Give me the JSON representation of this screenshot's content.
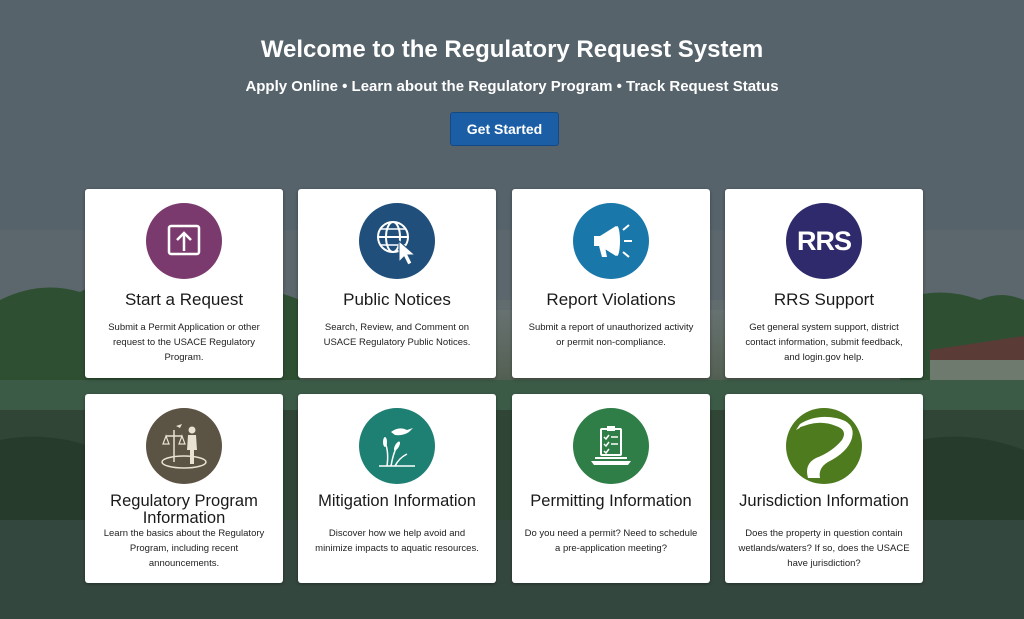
{
  "hero": {
    "title": "Welcome to the Regulatory Request System",
    "subtitle": "Apply Online • Learn about the Regulatory Program • Track Request Status",
    "cta_label": "Get Started"
  },
  "cards": [
    {
      "title": "Start a Request",
      "description": "Submit a Permit Application or other request to the USACE Regulatory Program.",
      "icon": "upload-icon",
      "color": "#7b3a6e"
    },
    {
      "title": "Public Notices",
      "description": "Search, Review, and Comment on USACE Regulatory Public Notices.",
      "icon": "globe-cursor-icon",
      "color": "#1f4f7a"
    },
    {
      "title": "Report Violations",
      "description": "Submit a report of unauthorized activity or permit non-compliance.",
      "icon": "megaphone-icon",
      "color": "#1a77a9"
    },
    {
      "title": "RRS Support",
      "description": "Get general system support, district contact information, submit feedback, and login.gov help.",
      "icon": "rrs-logo",
      "icon_text": "RRS",
      "color": "#2e2a6b"
    },
    {
      "title": "Regulatory Program Information",
      "description": "Learn the basics about the Regulatory Program, including recent announcements.",
      "icon": "scales-person-icon",
      "color": "#5b5343"
    },
    {
      "title": "Mitigation Information",
      "description": "Discover how we help avoid and minimize impacts to aquatic resources.",
      "icon": "heron-wetland-icon",
      "color": "#1e7f73"
    },
    {
      "title": "Permitting Information",
      "description": "Do you need a permit? Need to schedule a pre-application meeting?",
      "icon": "checklist-laptop-icon",
      "color": "#2f7d47"
    },
    {
      "title": "Jurisdiction Information",
      "description": "Does the property in question contain wetlands/waters? If so, does the USACE have jurisdiction?",
      "icon": "river-icon",
      "color": "#4e7b1e"
    }
  ]
}
